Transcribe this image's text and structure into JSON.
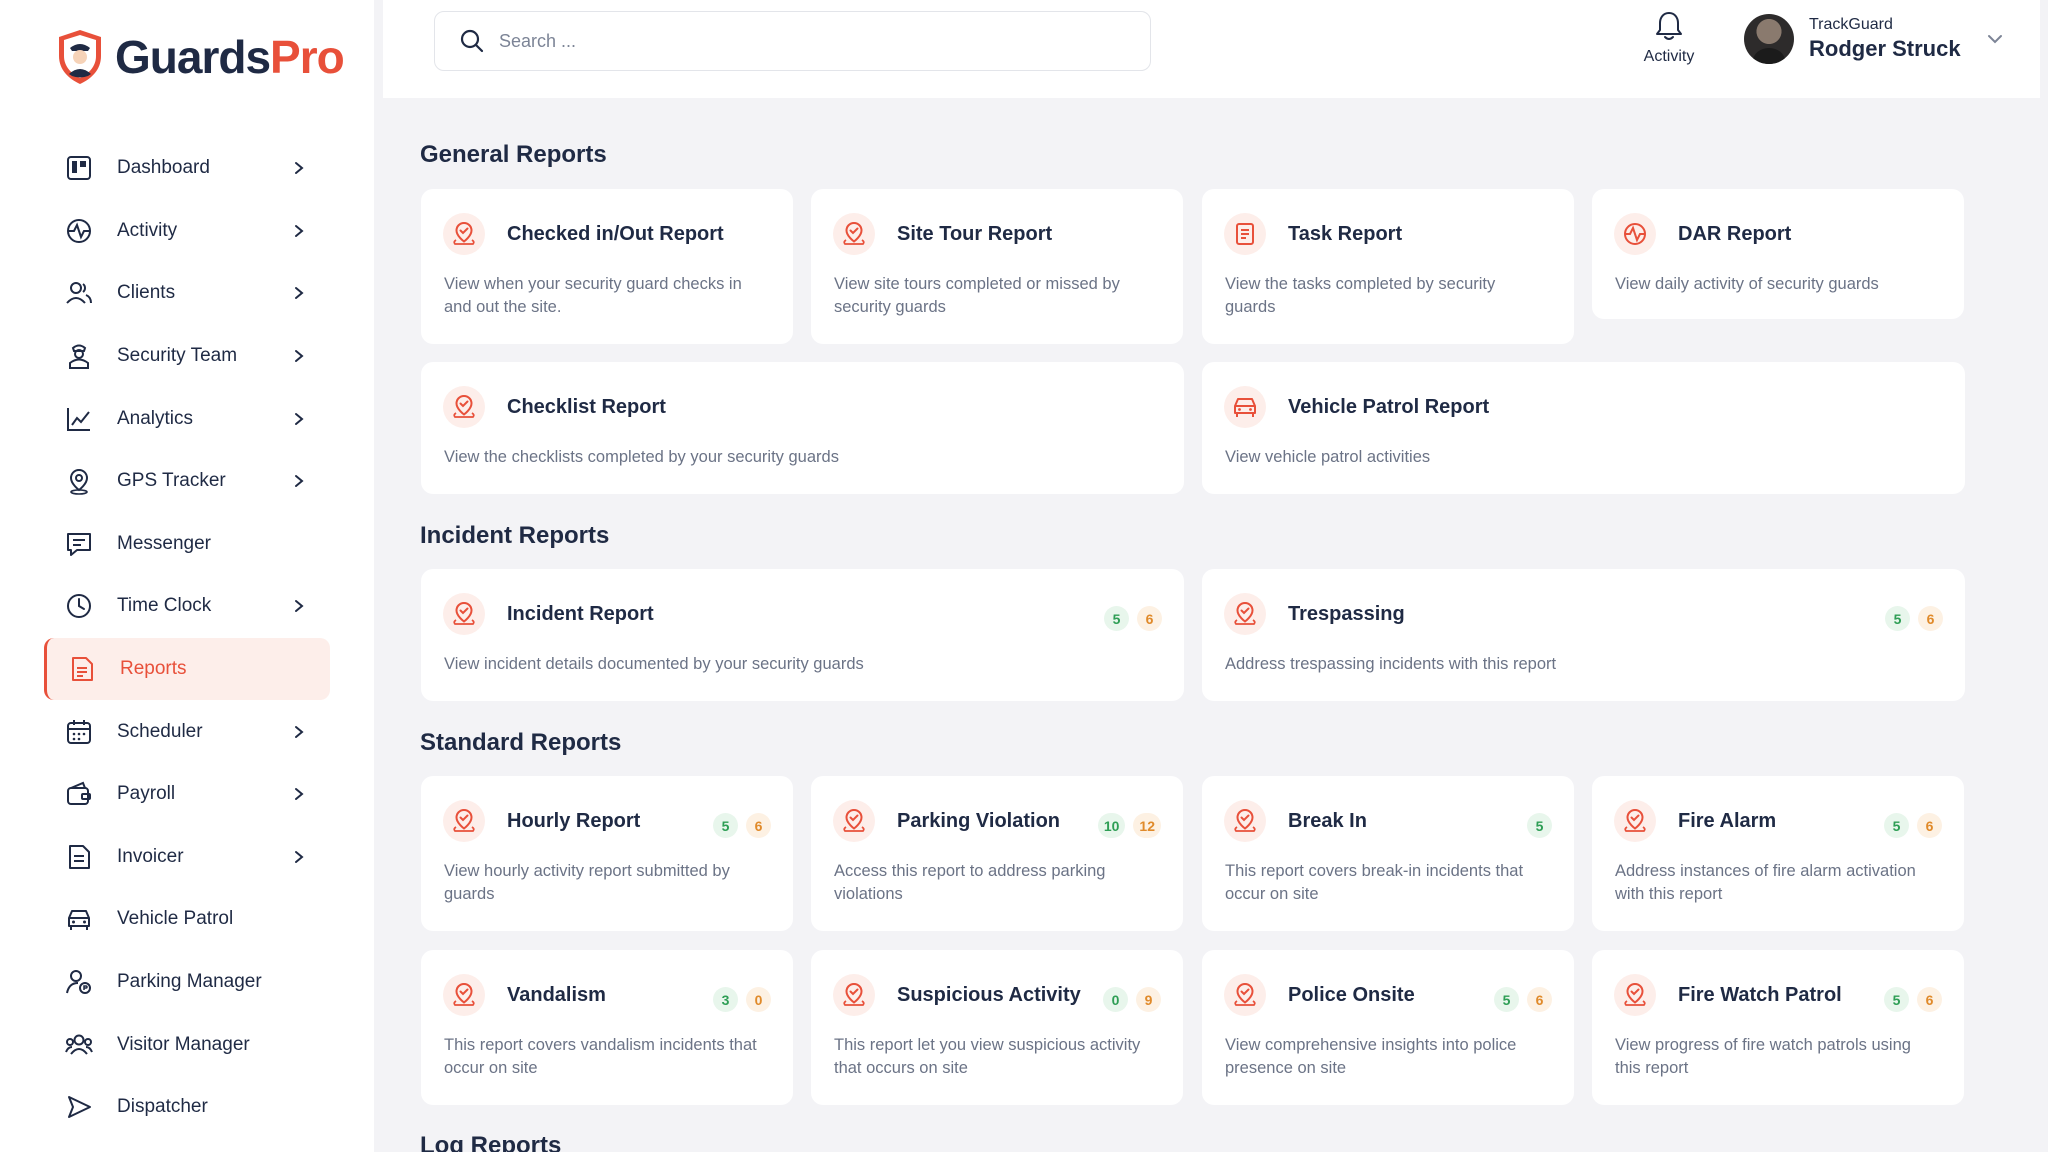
{
  "brand": {
    "part1": "Guards",
    "part2": "Pro"
  },
  "sidebar": {
    "items": [
      {
        "label": "Dashboard",
        "icon": "dashboard-icon",
        "chevron": true,
        "active": false
      },
      {
        "label": "Activity",
        "icon": "activity-icon",
        "chevron": true,
        "active": false
      },
      {
        "label": "Clients",
        "icon": "clients-icon",
        "chevron": true,
        "active": false
      },
      {
        "label": "Security Team",
        "icon": "security-team-icon",
        "chevron": true,
        "active": false
      },
      {
        "label": "Analytics",
        "icon": "analytics-icon",
        "chevron": true,
        "active": false
      },
      {
        "label": "GPS Tracker",
        "icon": "gps-pin-icon",
        "chevron": true,
        "active": false
      },
      {
        "label": "Messenger",
        "icon": "messenger-icon",
        "chevron": false,
        "active": false
      },
      {
        "label": "Time Clock",
        "icon": "clock-icon",
        "chevron": true,
        "active": false
      },
      {
        "label": "Reports",
        "icon": "reports-icon",
        "chevron": false,
        "active": true
      },
      {
        "label": "Scheduler",
        "icon": "calendar-icon",
        "chevron": true,
        "active": false
      },
      {
        "label": "Payroll",
        "icon": "payroll-icon",
        "chevron": true,
        "active": false
      },
      {
        "label": "Invoicer",
        "icon": "invoice-icon",
        "chevron": true,
        "active": false
      },
      {
        "label": "Vehicle Patrol",
        "icon": "car-icon",
        "chevron": false,
        "active": false
      },
      {
        "label": "Parking Manager",
        "icon": "parking-manager-icon",
        "chevron": false,
        "active": false
      },
      {
        "label": "Visitor Manager",
        "icon": "visitor-icon",
        "chevron": false,
        "active": false
      },
      {
        "label": "Dispatcher",
        "icon": "dispatch-icon",
        "chevron": false,
        "active": false
      }
    ]
  },
  "topbar": {
    "search_placeholder": "Search ...",
    "activity_label": "Activity",
    "user_org": "TrackGuard",
    "user_name": "Rodger Struck"
  },
  "sections": {
    "general": "General Reports",
    "incident": "Incident Reports",
    "standard": "Standard Reports",
    "log": "Log Reports"
  },
  "general_reports": [
    {
      "title": "Checked in/Out Report",
      "desc": "View when your security guard checks in and out the site.",
      "icon": "pin-icon"
    },
    {
      "title": "Site Tour  Report",
      "desc": "View site tours completed or missed by security guards",
      "icon": "pin-icon"
    },
    {
      "title": "Task Report",
      "desc": "View the tasks completed by security guards",
      "icon": "task-list-icon"
    },
    {
      "title": "DAR Report",
      "desc": "View daily activity of security guards",
      "icon": "pulse-icon"
    },
    {
      "title": "Checklist Report",
      "desc": "View the checklists completed by your security guards",
      "icon": "pin-icon"
    },
    {
      "title": "Vehicle Patrol Report",
      "desc": "View vehicle patrol activities",
      "icon": "car-icon"
    }
  ],
  "incident_reports": [
    {
      "title": "Incident Report",
      "desc": "View incident details documented by your security guards",
      "green": "5",
      "orange": "6"
    },
    {
      "title": "Trespassing",
      "desc": "Address trespassing incidents with this report",
      "green": "5",
      "orange": "6"
    }
  ],
  "standard_reports": [
    {
      "title": "Hourly Report",
      "desc": "View hourly activity report submitted by guards",
      "green": "5",
      "orange": "6"
    },
    {
      "title": "Parking Violation",
      "desc": "Access this report to address parking violations",
      "green": "10",
      "orange": "12"
    },
    {
      "title": "Break In",
      "desc": "This report covers break-in incidents that occur on site",
      "green": "5",
      "orange": null
    },
    {
      "title": "Fire Alarm",
      "desc": "Address instances of fire alarm activation with this report",
      "green": "5",
      "orange": "6"
    },
    {
      "title": "Vandalism",
      "desc": "This report covers vandalism incidents that occur on site",
      "green": "3",
      "orange": "0"
    },
    {
      "title": "Suspicious Activity",
      "desc": "This report let you view suspicious activity that occurs on site",
      "green": "0",
      "orange": "9"
    },
    {
      "title": "Police Onsite",
      "desc": "View comprehensive insights into police presence on site",
      "green": "5",
      "orange": "6"
    },
    {
      "title": "Fire Watch Patrol",
      "desc": "View progress of fire watch patrols using this report",
      "green": "5",
      "orange": "6"
    }
  ],
  "colors": {
    "accent": "#e8503a",
    "navy": "#1f2a44",
    "green": "#2e9e55",
    "orange": "#e08a2a"
  }
}
